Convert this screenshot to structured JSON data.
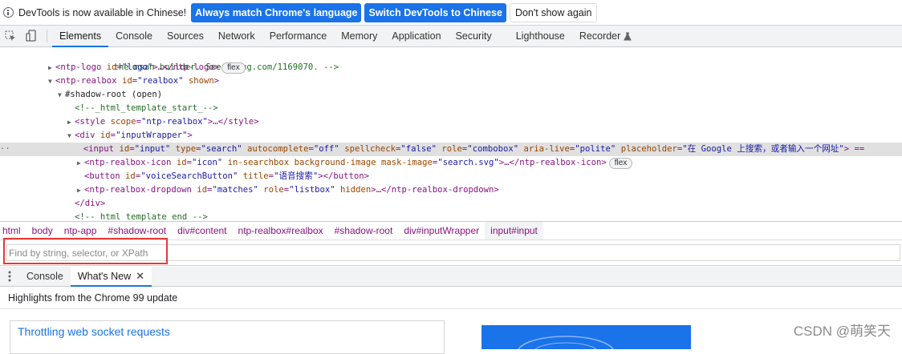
{
  "infobar": {
    "message": "DevTools is now available in Chinese!",
    "match_button": "Always match Chrome's language",
    "switch_button": "Switch DevTools to Chinese",
    "dismiss_button": "Don't show again"
  },
  "toolbar": {
    "tabs": [
      "Elements",
      "Console",
      "Sources",
      "Network",
      "Performance",
      "Memory",
      "Application",
      "Security",
      "Lighthouse",
      "Recorder"
    ],
    "active_tab": "Elements"
  },
  "tree": {
    "line0": "the msan builder. See crbug.com/1169070. -->",
    "line1_tag_open": "<ntp-logo",
    "line1_attr": "id",
    "line1_val": "\"logo\"",
    "line1_tail": ">…</ntp-logo>",
    "line1_badge": "flex",
    "line2_tag_open": "<ntp-realbox",
    "line2_attr1": "id",
    "line2_val1": "\"realbox\"",
    "line2_attr2": "shown",
    "line2_tail": ">",
    "line3_text": "#shadow-root (open)",
    "line4_comment": "<!--_html_template_start_-->",
    "line5_tag_open": "<style",
    "line5_attr": "scope",
    "line5_val": "\"ntp-realbox\"",
    "line5_tail": ">…</style>",
    "line6_tag_open": "<div",
    "line6_attr": "id",
    "line6_val": "\"inputWrapper\"",
    "line6_tail": ">",
    "line7_dots": "··",
    "line7_tag_open": "<input",
    "line7_a1": "id",
    "line7_v1": "\"input\"",
    "line7_a2": "type",
    "line7_v2": "\"search\"",
    "line7_a3": "autocomplete",
    "line7_v3": "\"off\"",
    "line7_a4": "spellcheck",
    "line7_v4": "\"false\"",
    "line7_a5": "role",
    "line7_v5": "\"combobox\"",
    "line7_a6": "aria-live",
    "line7_v6": "\"polite\"",
    "line7_a7": "placeholder",
    "line7_v7": "\"在 Google 上搜索，或者输入一个网址\"",
    "line7_tail": "> ==",
    "line8_tag_open": "<ntp-realbox-icon",
    "line8_a1": "id",
    "line8_v1": "\"icon\"",
    "line8_a2": "in-searchbox",
    "line8_a3": "background-image",
    "line8_a4": "mask-image",
    "line8_v4": "\"search.svg\"",
    "line8_tail": ">…</ntp-realbox-icon>",
    "line8_badge": "flex",
    "line9_tag_open": "<button",
    "line9_a1": "id",
    "line9_v1": "\"voiceSearchButton\"",
    "line9_a2": "title",
    "line9_v2": "\"语音搜索\"",
    "line9_tail": "></button>",
    "line10_tag_open": "<ntp-realbox-dropdown",
    "line10_a1": "id",
    "line10_v1": "\"matches\"",
    "line10_a2": "role",
    "line10_v2": "\"listbox\"",
    "line10_a3": "hidden",
    "line10_tail": ">…</ntp-realbox-dropdown>",
    "line11_close": "</div>",
    "line12_comment": "<!--_html_template_end_-->"
  },
  "breadcrumbs": [
    "html",
    "body",
    "ntp-app",
    "#shadow-root",
    "div#content",
    "ntp-realbox#realbox",
    "#shadow-root",
    "div#inputWrapper",
    "input#input"
  ],
  "search": {
    "placeholder": "Find by string, selector, or XPath"
  },
  "drawer": {
    "tabs": [
      "Console",
      "What's New"
    ],
    "active_tab": "What's New",
    "highlights": "Highlights from the Chrome 99 update",
    "card_title": "Throttling web socket requests"
  },
  "watermark": "CSDN @萌笑天",
  "colors": {
    "accent": "#1a73e8",
    "tag": "#881280",
    "attr": "#994500",
    "value": "#1a1aa6",
    "comment": "#236e25",
    "highlight_box": "#e53935"
  }
}
